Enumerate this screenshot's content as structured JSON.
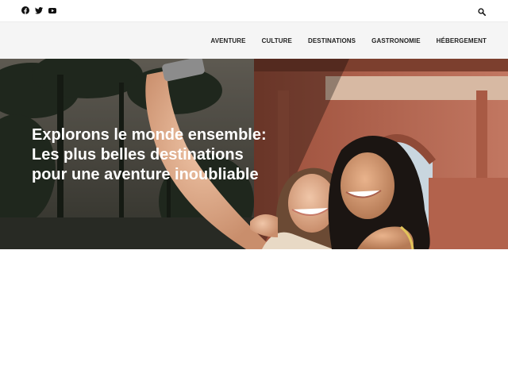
{
  "social": {
    "items": [
      {
        "icon": "facebook-icon"
      },
      {
        "icon": "twitter-icon"
      },
      {
        "icon": "youtube-icon"
      }
    ]
  },
  "search": {
    "icon": "search-icon"
  },
  "nav": {
    "items": [
      {
        "label": "AVENTURE"
      },
      {
        "label": "CULTURE"
      },
      {
        "label": "DESTINATIONS"
      },
      {
        "label": "GASTRONOMIE"
      },
      {
        "label": "HÉBERGEMENT"
      }
    ]
  },
  "hero": {
    "title_lines": [
      "Explorons le monde ensemble:",
      "Les plus belles destinations",
      "pour une aventure inoubliable"
    ]
  },
  "colors": {
    "nav_background": "#f5f5f5",
    "nav_text": "#222222",
    "hero_text": "#ffffff",
    "arch_brick": "#b8654f"
  }
}
